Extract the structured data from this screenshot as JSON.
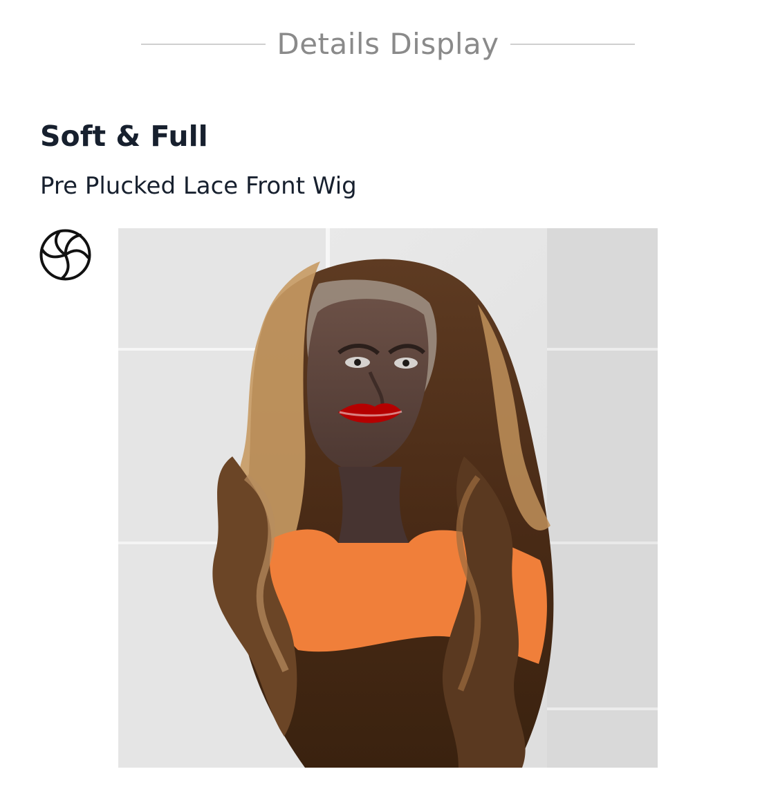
{
  "section": {
    "title": "Details Display"
  },
  "feature": {
    "title": "Soft & Full",
    "subtitle": "Pre Plucked Lace Front Wig",
    "icon": "aperture-icon"
  },
  "image": {
    "description_name": "product-image",
    "subject": "wig on mannequin head"
  },
  "colors": {
    "divider": "#cfcfcf",
    "section_title": "#8a8a8a",
    "heading": "#17202e"
  }
}
